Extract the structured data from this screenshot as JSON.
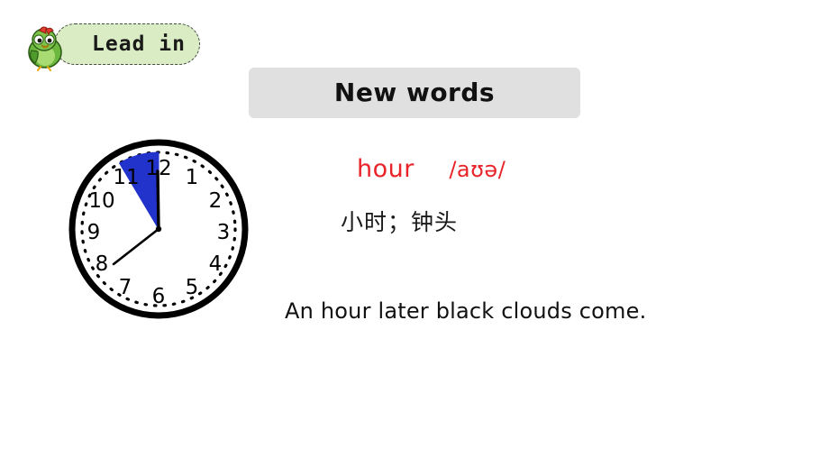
{
  "slide": {
    "background_color": "#ffffff"
  },
  "lead_in": {
    "label": "Lead in",
    "pill_color": "#d9ecc3",
    "border_color": "#4a4a4a",
    "mascot": "parrot-mascot-icon"
  },
  "heading": {
    "title": "New words",
    "box_color": "#e0e0e0",
    "text_color": "#111111"
  },
  "word_card": {
    "word": "hour",
    "phonetic": "/aʊə/",
    "translation": "小时；钟头",
    "example": "An hour later black clouds come.",
    "word_color": "#e8242a"
  },
  "clock": {
    "name": "analog-clock-illustration",
    "numerals": [
      "12",
      "1",
      "2",
      "3",
      "4",
      "5",
      "6",
      "7",
      "8",
      "9",
      "10",
      "11"
    ],
    "hour_hand_value": "12",
    "minute_hand_value": "8",
    "highlight_sector_color": "#2233cc",
    "face_color": "#ffffff",
    "rim_color": "#000000"
  }
}
